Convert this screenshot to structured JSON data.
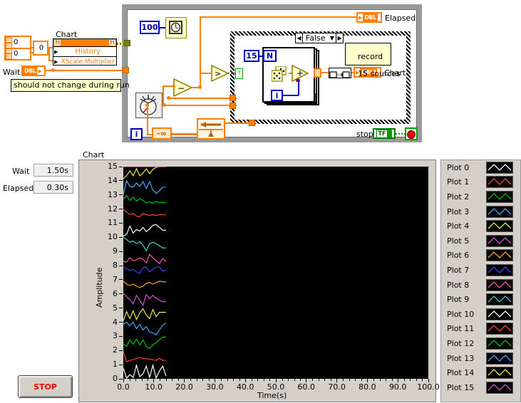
{
  "block_diagram": {
    "labels": {
      "chart_property_node": "Chart",
      "history": "History",
      "xscale_multiplier": "XScale.Multiplier",
      "wait": "Wait",
      "comment_no_change": "should not change during run",
      "elapsed": "Elapsed",
      "chart_out": "Chart",
      "stop": "stop",
      "record_comment_line1": "record",
      "record_comment_line2": "15 sources",
      "case_value": "False",
      "loop_count": "15",
      "n_terminal": "N",
      "i_terminal": "i",
      "i_terminal_loop": "i",
      "wait_ms_const": "100",
      "neg_inf_const": "-∞",
      "cluster_val_1": "0",
      "cluster_val_2": "0",
      "cluster_val_3": "0",
      "dbl_type": "DBL",
      "dbl_array_type": "DBL]",
      "bool_type": "TF"
    }
  },
  "front_panel": {
    "wait_label": "Wait",
    "wait_value": "1.50s",
    "elapsed_label": "Elapsed",
    "elapsed_value": "0.30s",
    "chart_label": "Chart",
    "stop_button": "STOP"
  },
  "colors": {
    "plot_palette": [
      "#ffffff",
      "#ff4040",
      "#00c000",
      "#40a8ff",
      "#e8e84c",
      "#cc55cc",
      "#ffa030",
      "#4040ff",
      "#ff55aa",
      "#40d0d0",
      "#ffffff",
      "#ff4040",
      "#00c000",
      "#40a8ff",
      "#e8e84c",
      "#cc55cc"
    ],
    "chart_bg": "#000000",
    "panel_bg": "#d4d0c8",
    "wire_orange": "#ff8000",
    "wire_blue": "#0000cd",
    "stop_red": "#ff0000",
    "constant_blue": "#0000cd"
  },
  "chart_data": {
    "type": "line",
    "title": "Chart",
    "xlabel": "Time(s)",
    "ylabel": "Amplitude",
    "xlim": [
      0.0,
      100.0
    ],
    "ylim": [
      0,
      15
    ],
    "xticks": [
      "0.0",
      "10.0",
      "20.0",
      "30.0",
      "40.0",
      "50.0",
      "60.0",
      "70.0",
      "80.0",
      "90.0",
      "100.0"
    ],
    "yticks": [
      "0",
      "1",
      "2",
      "3",
      "4",
      "5",
      "6",
      "7",
      "8",
      "9",
      "10",
      "11",
      "12",
      "13",
      "14",
      "15"
    ],
    "grid": false,
    "legend_position": "right",
    "data_extent_seconds": 14.0,
    "series": [
      {
        "name": "Plot 0",
        "color": "#ffffff",
        "offset": 0,
        "values": [
          0.75,
          0.05,
          0.3,
          0.1,
          0.95,
          0.15,
          0.35,
          0.9,
          0.1,
          0.95,
          0.05,
          0.55,
          0.9,
          0.2
        ]
      },
      {
        "name": "Plot 1",
        "color": "#ff4040",
        "offset": 1,
        "values": [
          1.95,
          1.2,
          1.3,
          1.35,
          1.45,
          1.5,
          1.45,
          1.4,
          1.4,
          1.35,
          1.3,
          1.45,
          1.3,
          1.3
        ]
      },
      {
        "name": "Plot 2",
        "color": "#00c000",
        "offset": 2,
        "values": [
          2.45,
          2.3,
          2.75,
          2.45,
          2.8,
          2.4,
          2.75,
          2.3,
          2.15,
          2.4,
          2.55,
          2.75,
          2.95,
          2.95
        ]
      },
      {
        "name": "Plot 3",
        "color": "#40a8ff",
        "offset": 3,
        "values": [
          3.85,
          4.0,
          3.75,
          4.0,
          3.55,
          3.85,
          3.45,
          3.7,
          3.3,
          3.25,
          3.1,
          3.45,
          3.8,
          3.95
        ]
      },
      {
        "name": "Plot 4",
        "color": "#e8e84c",
        "offset": 4,
        "values": [
          4.1,
          4.75,
          4.25,
          4.8,
          4.2,
          4.65,
          4.95,
          4.5,
          4.25,
          4.9,
          4.4,
          4.7,
          4.7,
          4.7
        ]
      },
      {
        "name": "Plot 5",
        "color": "#cc55cc",
        "offset": 5,
        "values": [
          6.05,
          5.8,
          5.6,
          5.3,
          5.9,
          5.55,
          5.2,
          5.95,
          5.65,
          5.9,
          5.7,
          5.55,
          5.45,
          5.45
        ]
      },
      {
        "name": "Plot 6",
        "color": "#ffa030",
        "offset": 6,
        "values": [
          6.9,
          6.7,
          6.6,
          6.7,
          6.55,
          6.45,
          6.55,
          6.75,
          6.8,
          6.7,
          6.8,
          6.9,
          6.85,
          6.85
        ]
      },
      {
        "name": "Plot 7",
        "color": "#4040ff",
        "offset": 7,
        "values": [
          7.85,
          7.8,
          7.65,
          7.75,
          7.55,
          7.45,
          7.85,
          7.9,
          7.55,
          7.75,
          7.9,
          7.9,
          7.6,
          7.7
        ]
      },
      {
        "name": "Plot 8",
        "color": "#ff55aa",
        "offset": 8,
        "values": [
          8.3,
          8.25,
          8.55,
          8.35,
          8.4,
          8.55,
          8.45,
          8.2,
          8.8,
          8.55,
          8.35,
          8.15,
          8.5,
          8.3
        ]
      },
      {
        "name": "Plot 9",
        "color": "#40d0d0",
        "offset": 9,
        "values": [
          10.0,
          9.85,
          9.65,
          9.75,
          9.55,
          9.7,
          9.45,
          9.05,
          9.55,
          9.65,
          9.55,
          9.4,
          9.25,
          9.25
        ]
      },
      {
        "name": "Plot 10",
        "color": "#ffffff",
        "offset": 10,
        "values": [
          10.1,
          10.2,
          10.8,
          10.3,
          10.55,
          10.45,
          10.7,
          10.4,
          10.6,
          10.85,
          10.9,
          10.7,
          10.5,
          10.5
        ]
      },
      {
        "name": "Plot 11",
        "color": "#ff4040",
        "offset": 11,
        "values": [
          11.95,
          11.8,
          11.6,
          11.7,
          11.5,
          11.45,
          11.7,
          11.6,
          11.55,
          11.6,
          11.55,
          11.6,
          11.6,
          11.6
        ]
      },
      {
        "name": "Plot 12",
        "color": "#00c000",
        "offset": 12,
        "values": [
          12.7,
          12.95,
          12.6,
          12.85,
          12.55,
          12.75,
          12.6,
          12.45,
          12.5,
          12.4,
          12.55,
          12.45,
          12.45,
          12.45
        ]
      },
      {
        "name": "Plot 13",
        "color": "#40a8ff",
        "offset": 13,
        "values": [
          13.0,
          14.0,
          13.6,
          13.55,
          13.85,
          13.6,
          13.95,
          13.45,
          13.95,
          13.35,
          13.1,
          13.3,
          13.55,
          13.55
        ]
      },
      {
        "name": "Plot 14",
        "color": "#e8e84c",
        "offset": 14,
        "values": [
          14.15,
          14.35,
          14.7,
          14.35,
          14.85,
          14.35,
          14.55,
          14.85,
          14.5,
          14.8,
          14.95,
          15.0,
          15.0,
          15.0
        ]
      },
      {
        "name": "Plot 15",
        "color": "#cc55cc",
        "offset": 15,
        "values": [
          15.0,
          15.0,
          15.0,
          15.0,
          15.0,
          15.0,
          15.0,
          15.0,
          15.0,
          15.0,
          15.0,
          15.0,
          15.0,
          15.0
        ]
      }
    ],
    "legend": [
      {
        "label": "Plot 0",
        "color": "#ffffff"
      },
      {
        "label": "Plot 1",
        "color": "#ff4040"
      },
      {
        "label": "Plot 2",
        "color": "#00c000"
      },
      {
        "label": "Plot 3",
        "color": "#40a8ff"
      },
      {
        "label": "Plot 4",
        "color": "#e8e84c"
      },
      {
        "label": "Plot 5",
        "color": "#cc55cc"
      },
      {
        "label": "Plot 6",
        "color": "#ffa030"
      },
      {
        "label": "Plot 7",
        "color": "#4040ff"
      },
      {
        "label": "Plot 8",
        "color": "#ff55aa"
      },
      {
        "label": "Plot 9",
        "color": "#40d0d0"
      },
      {
        "label": "Plot 10",
        "color": "#ffffff"
      },
      {
        "label": "Plot 11",
        "color": "#ff4040"
      },
      {
        "label": "Plot 12",
        "color": "#00c000"
      },
      {
        "label": "Plot 13",
        "color": "#40a8ff"
      },
      {
        "label": "Plot 14",
        "color": "#e8e84c"
      },
      {
        "label": "Plot 15",
        "color": "#cc55cc"
      }
    ]
  }
}
